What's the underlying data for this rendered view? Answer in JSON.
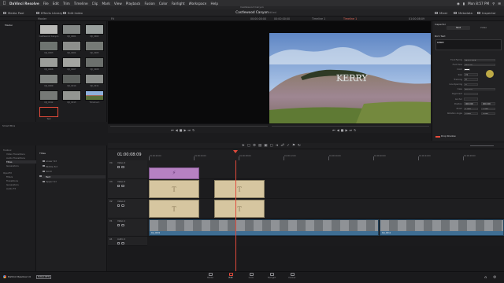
{
  "menubar": {
    "app_name": "DaVinci Resolve",
    "items": [
      "File",
      "Edit",
      "Trim",
      "Timeline",
      "Clip",
      "Mark",
      "View",
      "Playback",
      "Fusion",
      "Color",
      "Fairlight",
      "Workspace",
      "Help"
    ],
    "right_text": "Mon 8:57 PM"
  },
  "window_title": "Castlewood Canyon",
  "toolbar": {
    "media_pool": "Media Pool",
    "effects_library": "Effects Library",
    "edit_index": "Edit Index",
    "project_title": "Castlewood Canyon",
    "status": "Edited",
    "sound": "Mixer",
    "metadata": "Metadata",
    "inspector": "Inspector"
  },
  "subbar": {
    "bin": "Master",
    "src_zoom": "Fit",
    "src_tc": "00:00:00:00",
    "prg_tc_left": "00:00:00:00",
    "prg_tc": "01:00:08:09",
    "timeline_name": "Timeline 1",
    "prg_zoom": "Fit"
  },
  "media_list": {
    "items": [
      "Master",
      "Smart Bins"
    ]
  },
  "media_thumbs": [
    {
      "label": "Castlewood Canyon",
      "color": "#b9b9b6"
    },
    {
      "label": "DJI_0001",
      "color": "#848886"
    },
    {
      "label": "DJI_0002",
      "color": "#9aa09e"
    },
    {
      "label": "DJI_0003",
      "color": "#6e7470"
    },
    {
      "label": "DJI_0004",
      "color": "#8d8f8c"
    },
    {
      "label": "DJI_0005",
      "color": "#767a76"
    },
    {
      "label": "DJI_0006",
      "color": "#9c9e9a"
    },
    {
      "label": "DJI_0007",
      "color": "#a4a5a1"
    },
    {
      "label": "DJI_0008",
      "color": "#6c706d"
    },
    {
      "label": "DJI_0009",
      "color": "#7f8380"
    },
    {
      "label": "DJI_0010",
      "color": "#5e625f"
    },
    {
      "label": "DJI_0011",
      "color": "#8a8d8a"
    },
    {
      "label": "DJI_0012",
      "color": "#767976"
    },
    {
      "label": "DJI_0013",
      "color": "#939591"
    },
    {
      "label": "Timeline 1",
      "color": "#a16b5e"
    },
    {
      "label": "Text",
      "color": "#161616"
    }
  ],
  "viewer_overlay": "KERRY",
  "inspector": {
    "tabs": [
      "Text",
      "Video"
    ],
    "section": "Rich Text",
    "text_value": "KERRY",
    "rows": [
      {
        "label": "Font Family",
        "value": "Marker Felt"
      },
      {
        "label": "Font Face",
        "value": "Regular"
      },
      {
        "label": "Color",
        "value": ""
      },
      {
        "label": "Size",
        "value": "72"
      },
      {
        "label": "Tracking",
        "value": "0"
      },
      {
        "label": "Line Spacing",
        "value": "0"
      },
      {
        "label": "Case",
        "value": "Normal"
      },
      {
        "label": "Alignment",
        "value": ""
      },
      {
        "label": "Anchor",
        "value": ""
      },
      {
        "label": "Position",
        "value": "960.000"
      },
      {
        "label": "Zoom",
        "value": "1.000"
      },
      {
        "label": "Rotation Angle",
        "value": "0.000"
      }
    ],
    "drop_shadow": "Drop Shadow"
  },
  "effects_tree": {
    "items": [
      "Toolbox",
      "Video Transitions",
      "Audio Transitions",
      "Titles",
      "Generators",
      "OpenFX",
      "Filters",
      "Transitions",
      "Generators",
      "Audio FX"
    ]
  },
  "effects_list": {
    "header": "Titles",
    "items": [
      "Lower 3rd",
      "Middle 3rd",
      "Scroll",
      "Text",
      "Upper 3rd"
    ]
  },
  "timeline": {
    "timecode": "01:00:08:09",
    "ruler": [
      "01:00:00:00",
      "01:00:04:00",
      "01:00:08:00",
      "01:00:12:00",
      "01:00:16:00",
      "01:00:20:00",
      "01:00:24:00",
      "01:00:28:00",
      "01:00:32:00"
    ],
    "tracks": [
      {
        "id": "V4",
        "name": "Video 4",
        "kind": "video"
      },
      {
        "id": "V3",
        "name": "Video 3",
        "kind": "video"
      },
      {
        "id": "V2",
        "name": "Video 2",
        "kind": "video"
      },
      {
        "id": "V1",
        "name": "Video 1",
        "kind": "video"
      },
      {
        "id": "A1",
        "name": "Audio 1",
        "kind": "audio"
      }
    ],
    "clip_labels": [
      "DJI_0009",
      "DJI_0012"
    ],
    "colors": {
      "title": "#d6c6a0",
      "generator": "#b681c2",
      "video": "#3f6e93",
      "playhead": "#e04a3c"
    }
  },
  "footer": {
    "app_label": "DaVinci Resolve 14",
    "beta": "PUBLIC BETA",
    "pages": [
      "Media",
      "Edit",
      "Color",
      "Fairlight",
      "Deliver"
    ],
    "active_page": "Edit"
  }
}
